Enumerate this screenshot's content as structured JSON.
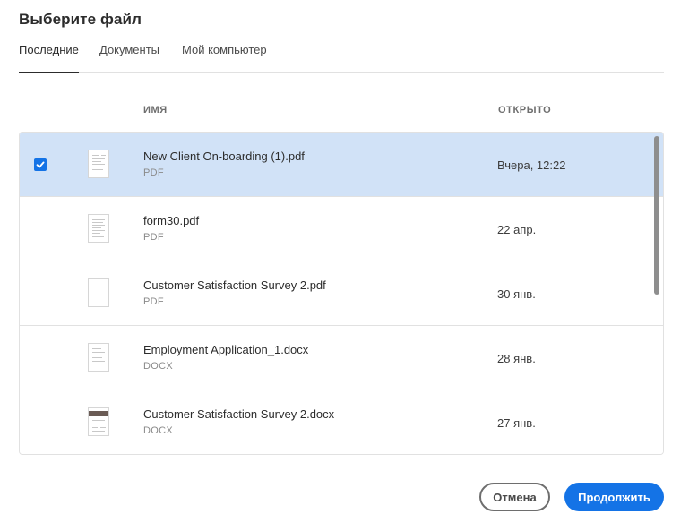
{
  "dialog": {
    "title": "Выберите файл"
  },
  "tabs": [
    {
      "label": "Последние",
      "active": true
    },
    {
      "label": "Документы",
      "active": false
    },
    {
      "label": "Мой компьютер",
      "active": false
    }
  ],
  "columns": {
    "name": "ИМЯ",
    "opened": "ОТКРЫТО"
  },
  "files": [
    {
      "name": "New Client On-boarding (1).pdf",
      "type": "PDF",
      "opened": "Вчера, 12:22",
      "selected": true
    },
    {
      "name": "form30.pdf",
      "type": "PDF",
      "opened": "22 апр.",
      "selected": false
    },
    {
      "name": "Customer Satisfaction Survey 2.pdf",
      "type": "PDF",
      "opened": "30 янв.",
      "selected": false
    },
    {
      "name": "Employment Application_1.docx",
      "type": "DOCX",
      "opened": "28 янв.",
      "selected": false
    },
    {
      "name": "Customer Satisfaction Survey 2.docx",
      "type": "DOCX",
      "opened": "27 янв.",
      "selected": false
    }
  ],
  "buttons": {
    "cancel": "Отмена",
    "continue": "Продолжить"
  },
  "colors": {
    "accent": "#1473e6",
    "selected_row": "#d1e2f7",
    "border": "#e1e1e1"
  },
  "icons": {
    "checkbox": "checkmark-icon",
    "file": "document-thumbnail-icon"
  }
}
